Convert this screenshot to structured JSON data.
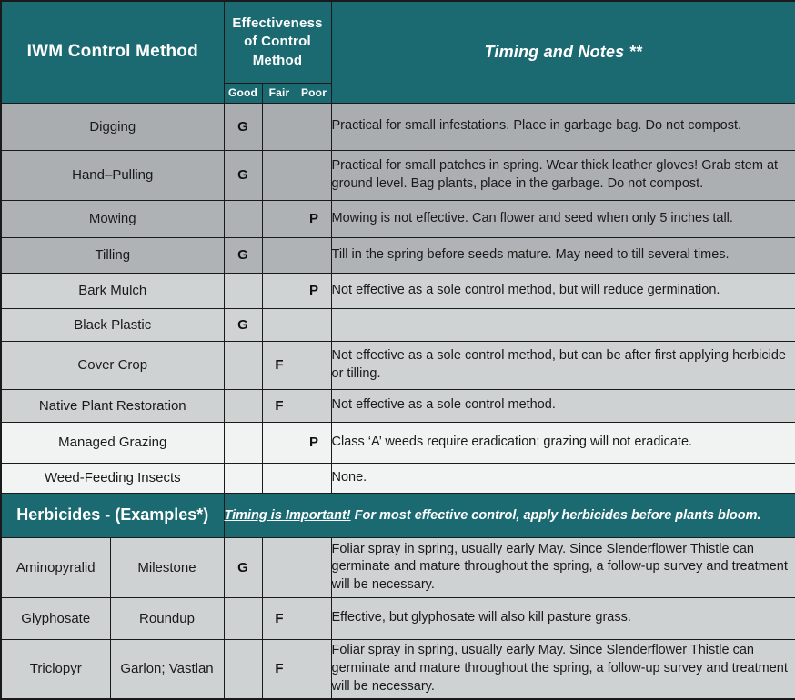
{
  "header": {
    "col_method": "IWM Control Method",
    "col_effectiveness": "Effectiveness of Control Method",
    "col_effectiveness_line1": "Effectiveness",
    "col_effectiveness_line2": "of Control",
    "col_effectiveness_line3": "Method",
    "sub_good": "Good",
    "sub_fair": "Fair",
    "sub_poor": "Poor",
    "col_notes": "Timing and Notes **"
  },
  "colors": {
    "header_teal": "#1b6a72",
    "header_text": "#ffffff",
    "grid_line": "#1a1a1a",
    "band_dark": "#a9adb0",
    "band_mid": "#cfd2d2",
    "band_light": "#f1f2f2"
  },
  "ratings": {
    "good": "G",
    "fair": "F",
    "poor": "P",
    "blank": ""
  },
  "rows": [
    {
      "method": "Digging",
      "good": "G",
      "fair": "",
      "poor": "",
      "notes": "Practical for small infestations. Place in garbage bag. Do not compost."
    },
    {
      "method": "Hand–Pulling",
      "good": "G",
      "fair": "",
      "poor": "",
      "notes": "Practical for small patches in spring.  Wear thick leather gloves!  Grab stem at ground level. Bag plants, place in the garbage. Do not compost."
    },
    {
      "method": "Mowing",
      "good": "",
      "fair": "",
      "poor": "P",
      "notes": "Mowing is not effective.  Can flower and seed when only 5 inches tall."
    },
    {
      "method": "Tilling",
      "good": "G",
      "fair": "",
      "poor": "",
      "notes": "Till in the spring before seeds mature.  May need to till several times."
    },
    {
      "method": "Bark Mulch",
      "good": "",
      "fair": "",
      "poor": "P",
      "notes": "Not effective as a sole control method, but will reduce germination."
    },
    {
      "method": "Black Plastic",
      "good": "G",
      "fair": "",
      "poor": "",
      "notes": ""
    },
    {
      "method": "Cover Crop",
      "good": "",
      "fair": "F",
      "poor": "",
      "notes": "Not effective as a sole control method, but can be after first applying herbicide or tilling."
    },
    {
      "method": "Native Plant Restoration",
      "good": "",
      "fair": "F",
      "poor": "",
      "notes": "Not effective as a sole control method."
    },
    {
      "method": "Managed Grazing",
      "good": "",
      "fair": "",
      "poor": "P",
      "notes": "Class ‘A’ weeds require eradication; grazing will not eradicate."
    },
    {
      "method": "Weed-Feeding Insects",
      "good": "",
      "fair": "",
      "poor": "",
      "notes": "None."
    }
  ],
  "herbicide_banner": {
    "title": "Herbicides - (Examples*)",
    "note_emphasis": "Timing is Important!",
    "note_rest": " For most effective control, apply herbicides before plants bloom."
  },
  "herbicide_rows": [
    {
      "chemical": "Aminopyralid",
      "product": "Milestone",
      "good": "G",
      "fair": "",
      "poor": "",
      "notes": "Foliar spray in spring, usually early May.  Since Slenderflower Thistle can germinate and mature throughout the spring, a follow-up survey and treatment will be necessary."
    },
    {
      "chemical": "Glyphosate",
      "product": "Roundup",
      "good": "",
      "fair": "F",
      "poor": "",
      "notes": "Effective, but glyphosate will also kill pasture grass."
    },
    {
      "chemical": "Triclopyr",
      "product": "Garlon; Vastlan",
      "good": "",
      "fair": "F",
      "poor": "",
      "notes": "Foliar spray in spring, usually early May.  Since Slenderflower Thistle can germinate and mature throughout the spring, a follow-up survey and treatment will be necessary."
    }
  ]
}
